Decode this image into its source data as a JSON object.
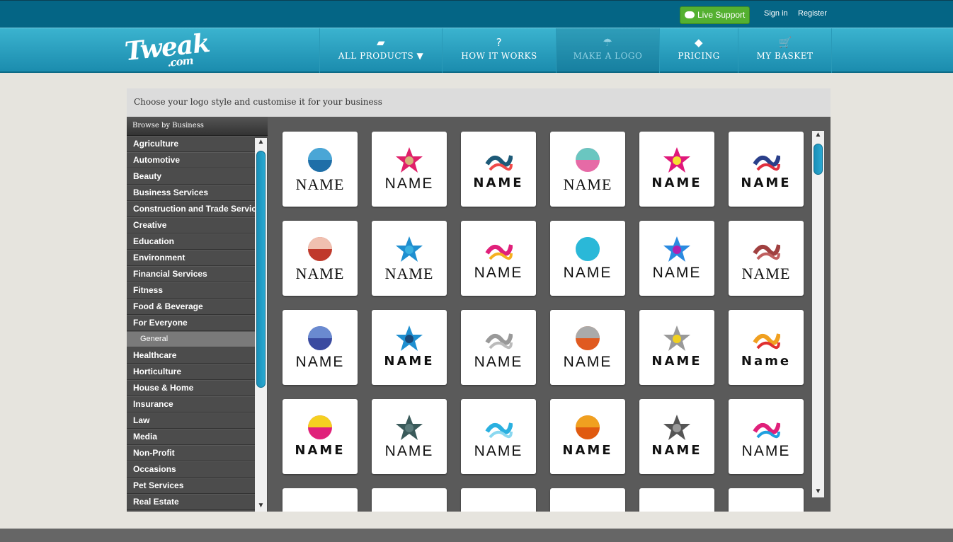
{
  "topbar": {
    "live_support": "Live Support",
    "sign_in": "Sign in",
    "register": "Register"
  },
  "brand": {
    "name": "Tweak",
    ".com": ".com",
    "suffix": ".com"
  },
  "nav": [
    {
      "label": "ALL PRODUCTS ▼",
      "icon": "folder-icon",
      "glyph": "▰"
    },
    {
      "label": "HOW IT WORKS",
      "icon": "question-icon",
      "glyph": "?"
    },
    {
      "label": "MAKE A LOGO",
      "icon": "umbrella-icon",
      "glyph": "☂",
      "active": true
    },
    {
      "label": "PRICING",
      "icon": "tag-icon",
      "glyph": "◆"
    },
    {
      "label": "MY BASKET",
      "icon": "cart-icon",
      "glyph": "🛒"
    }
  ],
  "page_header": "Choose your logo style and customise it for your business",
  "sidebar": {
    "title": "Browse by Business",
    "items": [
      {
        "label": "Agriculture"
      },
      {
        "label": "Automotive"
      },
      {
        "label": "Beauty"
      },
      {
        "label": "Business Services"
      },
      {
        "label": "Construction and Trade Services"
      },
      {
        "label": "Creative"
      },
      {
        "label": "Education"
      },
      {
        "label": "Environment"
      },
      {
        "label": "Financial Services"
      },
      {
        "label": "Fitness"
      },
      {
        "label": "Food & Beverage"
      },
      {
        "label": "For Everyone"
      },
      {
        "label": "General",
        "sub": true
      },
      {
        "label": "Healthcare"
      },
      {
        "label": "Horticulture"
      },
      {
        "label": "House & Home"
      },
      {
        "label": "Insurance"
      },
      {
        "label": "Law"
      },
      {
        "label": "Media"
      },
      {
        "label": "Non-Profit"
      },
      {
        "label": "Occasions"
      },
      {
        "label": "Pet Services"
      },
      {
        "label": "Real Estate"
      }
    ]
  },
  "logos": [
    {
      "text": "NAME",
      "style": "serif",
      "colors": [
        "#1f6fa8",
        "#4aa6d6"
      ]
    },
    {
      "text": "NAME",
      "style": "sans",
      "colors": [
        "#e0206a",
        "#d4b27a"
      ]
    },
    {
      "text": "NAME",
      "style": "bold",
      "colors": [
        "#1d5a78",
        "#f04a4a"
      ]
    },
    {
      "text": "NAME",
      "style": "serif",
      "colors": [
        "#e66aa6",
        "#6ac6c0"
      ]
    },
    {
      "text": "NAME",
      "style": "bold",
      "colors": [
        "#e0187a",
        "#f5e030"
      ]
    },
    {
      "text": "NAME",
      "style": "bold",
      "colors": [
        "#2a3f8a",
        "#e03040"
      ]
    },
    {
      "text": "NAME",
      "style": "serif",
      "colors": [
        "#c0392b",
        "#f0c0b0"
      ]
    },
    {
      "text": "NAME",
      "style": "serif",
      "colors": [
        "#1f8fd0",
        "#3ab0e0"
      ]
    },
    {
      "text": "NAME",
      "style": "sans",
      "colors": [
        "#e0207a",
        "#f5b020"
      ]
    },
    {
      "text": "NAME",
      "style": "sans",
      "colors": [
        "#2ab8d8",
        "#2ab8d8"
      ]
    },
    {
      "text": "NAME",
      "style": "sans",
      "colors": [
        "#2a8ae0",
        "#b020b0"
      ]
    },
    {
      "text": "NAME",
      "style": "serif",
      "colors": [
        "#a04040",
        "#c06060"
      ]
    },
    {
      "text": "NAME",
      "style": "sans",
      "colors": [
        "#3a4aa0",
        "#6a8ad0"
      ]
    },
    {
      "text": "NAME",
      "style": "bold",
      "colors": [
        "#1f8fd0",
        "#1a4a7a"
      ]
    },
    {
      "text": "NAME",
      "style": "sans",
      "colors": [
        "#999999",
        "#bbbbbb"
      ]
    },
    {
      "text": "NAME",
      "style": "sans",
      "colors": [
        "#e05a20",
        "#aaaaaa"
      ]
    },
    {
      "text": "NAME",
      "style": "bold",
      "colors": [
        "#999999",
        "#f0d020"
      ]
    },
    {
      "text": "Name",
      "style": "bold",
      "colors": [
        "#f0a020",
        "#e03030"
      ]
    },
    {
      "text": "NAME",
      "style": "bold",
      "colors": [
        "#e0207a",
        "#f5d020"
      ]
    },
    {
      "text": "NAME",
      "style": "sans",
      "colors": [
        "#3a5a5a",
        "#5a7a7a"
      ]
    },
    {
      "text": "NAME",
      "style": "sans",
      "colors": [
        "#2ab0e0",
        "#8ad8f0"
      ]
    },
    {
      "text": "NAME",
      "style": "bold",
      "colors": [
        "#e05a10",
        "#f0a020"
      ]
    },
    {
      "text": "NAME",
      "style": "bold",
      "colors": [
        "#555555",
        "#999999"
      ]
    },
    {
      "text": "NAME",
      "style": "sans",
      "colors": [
        "#e0207a",
        "#20a0e0"
      ]
    },
    {
      "text": "",
      "style": "sans",
      "colors": [
        "#ffffff",
        "#ffffff"
      ]
    },
    {
      "text": "",
      "style": "sans",
      "colors": [
        "#ffffff",
        "#ffffff"
      ]
    },
    {
      "text": "",
      "style": "sans",
      "colors": [
        "#ffffff",
        "#ffffff"
      ]
    },
    {
      "text": "",
      "style": "sans",
      "colors": [
        "#ffffff",
        "#ffffff"
      ]
    },
    {
      "text": "",
      "style": "sans",
      "colors": [
        "#ffffff",
        "#ffffff"
      ]
    },
    {
      "text": "",
      "style": "sans",
      "colors": [
        "#ffffff",
        "#ffffff"
      ]
    }
  ]
}
